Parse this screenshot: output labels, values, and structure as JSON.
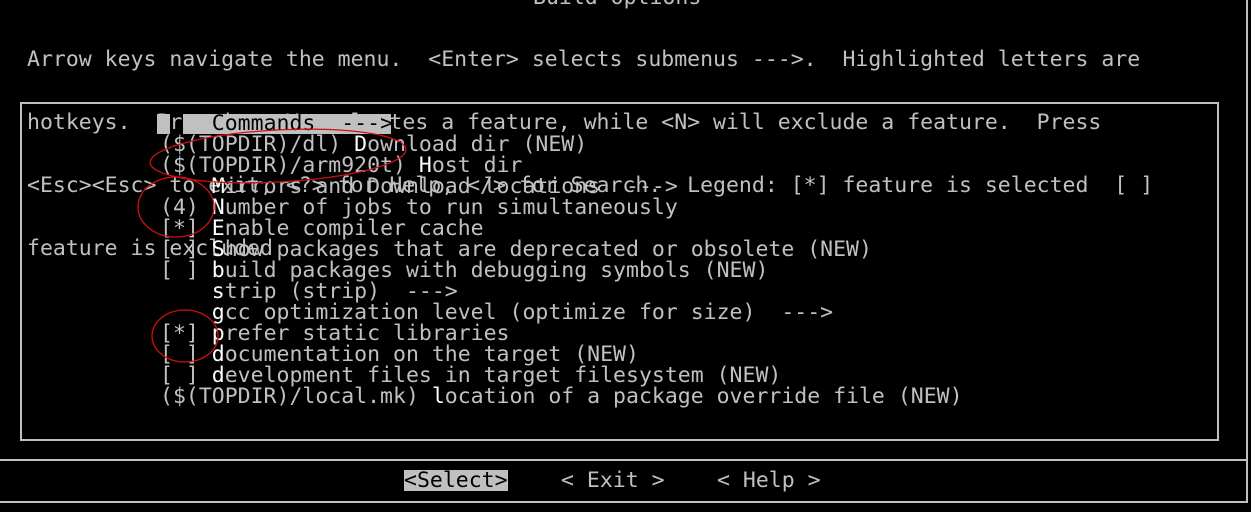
{
  "title": "Build Options",
  "help_lines": [
    "Arrow keys navigate the menu.  <Enter> selects submenus --->.  Highlighted letters are",
    "hotkeys.  Pressing <Y> selectes a feature, while <N> will exclude a feature.  Press",
    "<Esc><Esc> to exit, <?> for Help, </> for Search.  Legend: [*] feature is selected  [ ]",
    "feature is excluded"
  ],
  "menu": {
    "items": [
      {
        "prefix": "    ",
        "hotkey": "C",
        "rest": "ommands  --->",
        "selected": true
      },
      {
        "prefix": "($(TOPDIR)/dl) ",
        "hotkey": "D",
        "rest": "ownload dir (NEW)"
      },
      {
        "prefix": "($(TOPDIR)/arm920t) ",
        "hotkey": "H",
        "rest": "ost dir"
      },
      {
        "prefix": "    ",
        "hotkey": "M",
        "rest": "irrors and Download locations  --->"
      },
      {
        "prefix": "(4) ",
        "hotkey": "N",
        "rest": "umber of jobs to run simultaneously"
      },
      {
        "prefix": "[*] ",
        "hotkey": "E",
        "rest": "nable compiler cache"
      },
      {
        "prefix": "[ ] ",
        "hotkey": "S",
        "rest": "how packages that are deprecated or obsolete (NEW)"
      },
      {
        "prefix": "[ ] ",
        "hotkey": "b",
        "rest": "uild packages with debugging symbols (NEW)"
      },
      {
        "prefix": "    ",
        "hotkey": "s",
        "rest": "trip (strip)  --->"
      },
      {
        "prefix": "    ",
        "hotkey": "g",
        "rest": "cc optimization level (optimize for size)  --->"
      },
      {
        "prefix": "[*] ",
        "hotkey": "p",
        "rest": "refer static libraries"
      },
      {
        "prefix": "[ ] ",
        "hotkey": "d",
        "rest": "ocumentation on the target (NEW)"
      },
      {
        "prefix": "[ ] ",
        "hotkey": "d",
        "rest": "evelopment files in target filesystem (NEW)"
      },
      {
        "prefix": "($(TOPDIR)/local.mk) ",
        "hotkey": "l",
        "rest": "ocation of a package override file (NEW)"
      }
    ]
  },
  "buttons": {
    "select": "<Select>",
    "exit": "< Exit >",
    "help": "< Help >"
  },
  "colors": {
    "fg": "#c0c0c0",
    "hotkey": "#ffffff",
    "bg": "#000000",
    "annotation": "#d01010"
  }
}
